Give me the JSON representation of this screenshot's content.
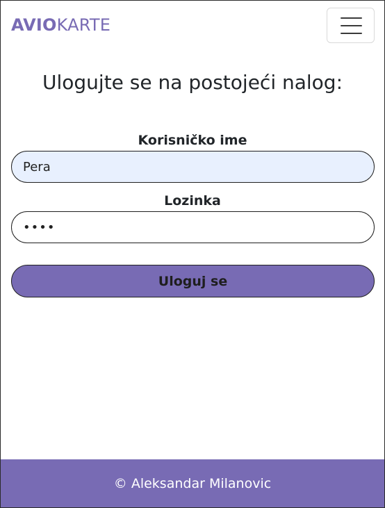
{
  "brand": {
    "part1": "AVIO",
    "part2": "KARTE"
  },
  "colors": {
    "accent": "#786bb4",
    "autofill": "#e8f0fe"
  },
  "navbar": {
    "toggler_icon": "hamburger-menu-icon"
  },
  "login": {
    "heading": "Ulogujte se na postojeći nalog:",
    "username_label": "Korisničko ime",
    "username_value": "Pera",
    "password_label": "Lozinka",
    "password_value": "pera",
    "submit_label": "Uloguj se"
  },
  "footer": {
    "text": "© Aleksandar Milanovic"
  }
}
